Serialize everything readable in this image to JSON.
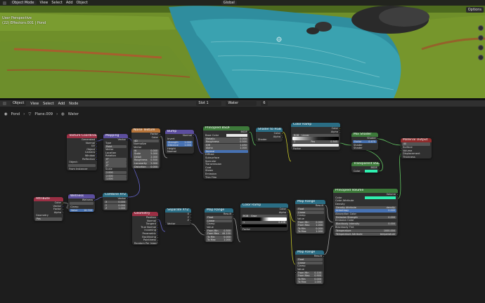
{
  "viewport": {
    "mode": "Object Mode",
    "menu": [
      "View",
      "Select",
      "Add",
      "Object"
    ],
    "orientation": "Global",
    "options_label": "Options",
    "info_line1": "User Perspective",
    "info_line2": "(22) Effectors.001 | Pond"
  },
  "node_editor": {
    "object_mode": "Object",
    "menu": [
      "View",
      "Select",
      "Add",
      "Node"
    ],
    "slot": "Slot 1",
    "material": "Water",
    "users": "6",
    "breadcrumb": [
      "Pond",
      "Plane.009",
      "Water"
    ]
  },
  "nodes": {
    "texcoord": {
      "title": "Texture Coordinate",
      "outputs": [
        "Generated",
        "Normal",
        "UV",
        "Object",
        "Camera",
        "Window",
        "Reflection"
      ],
      "object_label": "Object:",
      "from_instancer": "From Instancer"
    },
    "mapping": {
      "title": "Mapping",
      "out": "Vector",
      "type_label": "Type",
      "type": "Point",
      "rows": [
        "Vector",
        "Location",
        "Rotation"
      ],
      "rot": [
        "0°",
        "0°",
        "0°"
      ],
      "scale_label": "Scale",
      "scale": [
        "2.000",
        "2.000",
        "1.000"
      ]
    },
    "noise": {
      "title": "Noise Texture",
      "outs": [
        "Factor",
        "Color"
      ],
      "dim": "4D",
      "normalize": "Normalize",
      "vector": "Vector",
      "fields": [
        [
          "W",
          "0.000"
        ],
        [
          "Scale",
          "5.000"
        ],
        [
          "Detail",
          "2.000"
        ],
        [
          "Roughness",
          "0.500"
        ],
        [
          "Lacunarity",
          "2.000"
        ],
        [
          "Distortion",
          "0.000"
        ]
      ]
    },
    "bump": {
      "title": "Bump",
      "out": "Normal",
      "invert": "Invert",
      "fields": [
        [
          "Strength",
          "1.000"
        ],
        [
          "Distance",
          "1.000"
        ]
      ],
      "ins": [
        "Height",
        "Normal"
      ]
    },
    "principled": {
      "title": "Principled BSDF",
      "out": "BSDF",
      "base": "Base Color",
      "fields": [
        [
          "Metallic",
          "0.000"
        ],
        [
          "Roughness",
          "0.500"
        ],
        [
          "IOR",
          "1.450"
        ],
        [
          "Alpha",
          "1.000"
        ]
      ],
      "normal": "Normal",
      "sections": [
        "Diffuse",
        "Subsurface",
        "Specular",
        "Transmission",
        "Coat",
        "Sheen",
        "Emission",
        "Thin Film"
      ]
    },
    "s2rgb": {
      "title": "Shader to RGB",
      "outs": [
        "Color",
        "Alpha"
      ],
      "in": "Shader"
    },
    "ramp1": {
      "title": "Color Ramp",
      "outs": [
        "Color",
        "Alpha"
      ],
      "interp": "RGB",
      "mode": "Linear",
      "pos_label": "Pos",
      "pos": "0.545",
      "idx": "1",
      "fac": "Factor"
    },
    "mix": {
      "title": "Mix Shader",
      "out": "Shader",
      "fac_label": "Factor",
      "fac": "0.470",
      "ins": [
        "Shader",
        "Shader"
      ]
    },
    "transparent": {
      "title": "Transparent BSDF",
      "out": "BSDF",
      "color": "Color"
    },
    "output": {
      "title": "Material Output",
      "target": "All",
      "ins": [
        "Surface",
        "Volume",
        "Displacement",
        "Thickness"
      ]
    },
    "attribute": {
      "title": "Attribute",
      "outs": [
        "Color",
        "Vector",
        "Factor",
        "Alpha"
      ],
      "type": "Geometry",
      "name": "Pos"
    },
    "wetness": {
      "title": "Wetness",
      "out": "Wetness",
      "clamp": "Clamp",
      "value_label": "Value",
      "value": "18.700"
    },
    "combine": {
      "title": "Combine XYZ",
      "out": "Vector",
      "fields": [
        [
          "X",
          "0.000"
        ],
        [
          "Y",
          "0.000"
        ],
        [
          "Z",
          "1.000"
        ]
      ]
    },
    "geometry": {
      "title": "Geometry",
      "outs": [
        "Position",
        "Normal",
        "Tangent",
        "True Normal",
        "Incoming",
        "Parametric",
        "Backfacing",
        "Pointiness",
        "Random Per Island"
      ]
    },
    "separate": {
      "title": "Separate XYZ",
      "outs": [
        "X",
        "Y",
        "Z"
      ],
      "in": "Vector"
    },
    "maprange1": {
      "title": "Map Range",
      "out": "Result",
      "type": "Float",
      "interp": "Linear",
      "clamp": "Clamp",
      "in": "Value",
      "fields": [
        [
          "From Min",
          "0.500"
        ],
        [
          "From Max",
          "44.100"
        ],
        [
          "To Min",
          "0.000"
        ],
        [
          "To Max",
          "1.000"
        ]
      ]
    },
    "ramp2": {
      "title": "Color Ramp",
      "outs": [
        "Color",
        "Alpha"
      ],
      "interp": "RGB",
      "mode": "Ease",
      "pos": "0.438",
      "idx": "1",
      "fac": "Factor"
    },
    "maprange2": {
      "title": "Map Range",
      "out": "Result",
      "type": "Float",
      "interp": "Linear",
      "clamp": "Clamp",
      "in": "Value",
      "fields": [
        [
          "From Min",
          "0.000"
        ],
        [
          "From Max",
          "1.000"
        ],
        [
          "To Min",
          "0.000"
        ],
        [
          "To Max",
          "1.000"
        ]
      ]
    },
    "maprange3": {
      "title": "Map Range",
      "out": "Result",
      "type": "Float",
      "interp": "Linear",
      "clamp": "Clamp",
      "in": "Value",
      "fields": [
        [
          "From Min",
          "0.100"
        ],
        [
          "From Max",
          "0.900"
        ],
        [
          "To Min",
          "0.000"
        ],
        [
          "To Max",
          "1.000"
        ]
      ]
    },
    "volume": {
      "title": "Principled Volume",
      "out": "Volume",
      "rows": [
        "Color",
        "Color Attribute",
        "Density",
        "Density Attribute",
        "Anisotropy",
        "Absorption Color",
        "Emission Strength",
        "Emission Color",
        "Blackbody Intensity",
        "Blackbody Tint",
        "Temperature",
        "Temperature Attribute"
      ],
      "density_attr": "density",
      "anisotropy": "0.000",
      "temp": "temperature",
      "emit": "0.000",
      "blackbody": "0.000",
      "temperature": "1000.000"
    }
  },
  "colors": {
    "shader": "#3d7a3a",
    "color": "#6e6a22",
    "texture": "#b6743a",
    "vector": "#5c4e9e",
    "input": "#9a2f44",
    "converter": "#2a6d84",
    "output": "#8e2b2b",
    "sock_yellow": "#c7c729",
    "sock_grey": "#a1a1a1",
    "sock_green": "#63c763",
    "sock_purple": "#6363c7"
  }
}
